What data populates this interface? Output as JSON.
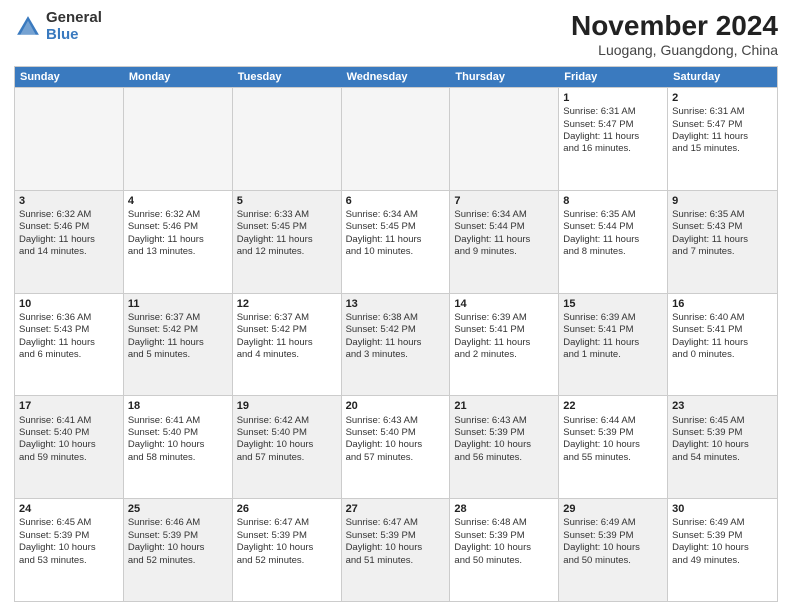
{
  "header": {
    "logo_general": "General",
    "logo_blue": "Blue",
    "title": "November 2024",
    "subtitle": "Luogang, Guangdong, China"
  },
  "days": [
    "Sunday",
    "Monday",
    "Tuesday",
    "Wednesday",
    "Thursday",
    "Friday",
    "Saturday"
  ],
  "rows": [
    [
      {
        "day": "",
        "empty": true
      },
      {
        "day": "",
        "empty": true
      },
      {
        "day": "",
        "empty": true
      },
      {
        "day": "",
        "empty": true
      },
      {
        "day": "",
        "empty": true
      },
      {
        "day": "1",
        "lines": [
          "Sunrise: 6:31 AM",
          "Sunset: 5:47 PM",
          "Daylight: 11 hours",
          "and 16 minutes."
        ]
      },
      {
        "day": "2",
        "lines": [
          "Sunrise: 6:31 AM",
          "Sunset: 5:47 PM",
          "Daylight: 11 hours",
          "and 15 minutes."
        ]
      }
    ],
    [
      {
        "day": "3",
        "shaded": true,
        "lines": [
          "Sunrise: 6:32 AM",
          "Sunset: 5:46 PM",
          "Daylight: 11 hours",
          "and 14 minutes."
        ]
      },
      {
        "day": "4",
        "lines": [
          "Sunrise: 6:32 AM",
          "Sunset: 5:46 PM",
          "Daylight: 11 hours",
          "and 13 minutes."
        ]
      },
      {
        "day": "5",
        "shaded": true,
        "lines": [
          "Sunrise: 6:33 AM",
          "Sunset: 5:45 PM",
          "Daylight: 11 hours",
          "and 12 minutes."
        ]
      },
      {
        "day": "6",
        "lines": [
          "Sunrise: 6:34 AM",
          "Sunset: 5:45 PM",
          "Daylight: 11 hours",
          "and 10 minutes."
        ]
      },
      {
        "day": "7",
        "shaded": true,
        "lines": [
          "Sunrise: 6:34 AM",
          "Sunset: 5:44 PM",
          "Daylight: 11 hours",
          "and 9 minutes."
        ]
      },
      {
        "day": "8",
        "lines": [
          "Sunrise: 6:35 AM",
          "Sunset: 5:44 PM",
          "Daylight: 11 hours",
          "and 8 minutes."
        ]
      },
      {
        "day": "9",
        "shaded": true,
        "lines": [
          "Sunrise: 6:35 AM",
          "Sunset: 5:43 PM",
          "Daylight: 11 hours",
          "and 7 minutes."
        ]
      }
    ],
    [
      {
        "day": "10",
        "lines": [
          "Sunrise: 6:36 AM",
          "Sunset: 5:43 PM",
          "Daylight: 11 hours",
          "and 6 minutes."
        ]
      },
      {
        "day": "11",
        "shaded": true,
        "lines": [
          "Sunrise: 6:37 AM",
          "Sunset: 5:42 PM",
          "Daylight: 11 hours",
          "and 5 minutes."
        ]
      },
      {
        "day": "12",
        "lines": [
          "Sunrise: 6:37 AM",
          "Sunset: 5:42 PM",
          "Daylight: 11 hours",
          "and 4 minutes."
        ]
      },
      {
        "day": "13",
        "shaded": true,
        "lines": [
          "Sunrise: 6:38 AM",
          "Sunset: 5:42 PM",
          "Daylight: 11 hours",
          "and 3 minutes."
        ]
      },
      {
        "day": "14",
        "lines": [
          "Sunrise: 6:39 AM",
          "Sunset: 5:41 PM",
          "Daylight: 11 hours",
          "and 2 minutes."
        ]
      },
      {
        "day": "15",
        "shaded": true,
        "lines": [
          "Sunrise: 6:39 AM",
          "Sunset: 5:41 PM",
          "Daylight: 11 hours",
          "and 1 minute."
        ]
      },
      {
        "day": "16",
        "lines": [
          "Sunrise: 6:40 AM",
          "Sunset: 5:41 PM",
          "Daylight: 11 hours",
          "and 0 minutes."
        ]
      }
    ],
    [
      {
        "day": "17",
        "shaded": true,
        "lines": [
          "Sunrise: 6:41 AM",
          "Sunset: 5:40 PM",
          "Daylight: 10 hours",
          "and 59 minutes."
        ]
      },
      {
        "day": "18",
        "lines": [
          "Sunrise: 6:41 AM",
          "Sunset: 5:40 PM",
          "Daylight: 10 hours",
          "and 58 minutes."
        ]
      },
      {
        "day": "19",
        "shaded": true,
        "lines": [
          "Sunrise: 6:42 AM",
          "Sunset: 5:40 PM",
          "Daylight: 10 hours",
          "and 57 minutes."
        ]
      },
      {
        "day": "20",
        "lines": [
          "Sunrise: 6:43 AM",
          "Sunset: 5:40 PM",
          "Daylight: 10 hours",
          "and 57 minutes."
        ]
      },
      {
        "day": "21",
        "shaded": true,
        "lines": [
          "Sunrise: 6:43 AM",
          "Sunset: 5:39 PM",
          "Daylight: 10 hours",
          "and 56 minutes."
        ]
      },
      {
        "day": "22",
        "lines": [
          "Sunrise: 6:44 AM",
          "Sunset: 5:39 PM",
          "Daylight: 10 hours",
          "and 55 minutes."
        ]
      },
      {
        "day": "23",
        "shaded": true,
        "lines": [
          "Sunrise: 6:45 AM",
          "Sunset: 5:39 PM",
          "Daylight: 10 hours",
          "and 54 minutes."
        ]
      }
    ],
    [
      {
        "day": "24",
        "lines": [
          "Sunrise: 6:45 AM",
          "Sunset: 5:39 PM",
          "Daylight: 10 hours",
          "and 53 minutes."
        ]
      },
      {
        "day": "25",
        "shaded": true,
        "lines": [
          "Sunrise: 6:46 AM",
          "Sunset: 5:39 PM",
          "Daylight: 10 hours",
          "and 52 minutes."
        ]
      },
      {
        "day": "26",
        "lines": [
          "Sunrise: 6:47 AM",
          "Sunset: 5:39 PM",
          "Daylight: 10 hours",
          "and 52 minutes."
        ]
      },
      {
        "day": "27",
        "shaded": true,
        "lines": [
          "Sunrise: 6:47 AM",
          "Sunset: 5:39 PM",
          "Daylight: 10 hours",
          "and 51 minutes."
        ]
      },
      {
        "day": "28",
        "lines": [
          "Sunrise: 6:48 AM",
          "Sunset: 5:39 PM",
          "Daylight: 10 hours",
          "and 50 minutes."
        ]
      },
      {
        "day": "29",
        "shaded": true,
        "lines": [
          "Sunrise: 6:49 AM",
          "Sunset: 5:39 PM",
          "Daylight: 10 hours",
          "and 50 minutes."
        ]
      },
      {
        "day": "30",
        "lines": [
          "Sunrise: 6:49 AM",
          "Sunset: 5:39 PM",
          "Daylight: 10 hours",
          "and 49 minutes."
        ]
      }
    ]
  ]
}
